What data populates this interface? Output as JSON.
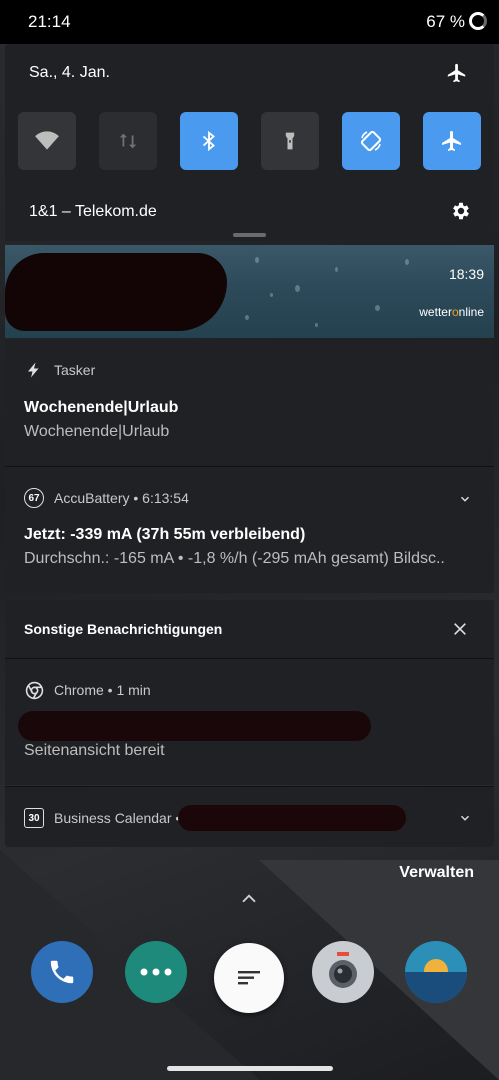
{
  "status_bar": {
    "time": "21:14",
    "battery": "67 %"
  },
  "quick_settings": {
    "date": "Sa., 4. Jan.",
    "operator": "1&1 – Telekom.de",
    "tiles": [
      {
        "icon": "wifi-icon",
        "state": "off"
      },
      {
        "icon": "mobile-data-icon",
        "state": "unavailable"
      },
      {
        "icon": "bluetooth-icon",
        "state": "on"
      },
      {
        "icon": "flashlight-icon",
        "state": "off"
      },
      {
        "icon": "auto-rotate-icon",
        "state": "on"
      },
      {
        "icon": "airplane-mode-icon",
        "state": "on"
      }
    ],
    "accent_color": "#4a9bef"
  },
  "weather": {
    "time": "18:39",
    "brand_left": "wetter",
    "brand_o": "o",
    "brand_right": "nline"
  },
  "notifications": {
    "tasker": {
      "app": "Tasker",
      "title": "Wochenende|Urlaub",
      "text": "Wochenende|Urlaub"
    },
    "accubattery": {
      "badge": "67",
      "app": "AccuBattery • 6:13:54",
      "title": "Jetzt: -339 mA (37h 55m verbleibend)",
      "text": "Durchschn.: -165 mA • -1,8 %/h (-295 mAh gesamt) Bildsc.."
    },
    "other_group": {
      "header": "Sonstige Benachrichtigungen",
      "chrome": {
        "app": "Chrome • 1 min",
        "text": "Seitenansicht bereit"
      },
      "calendar": {
        "badge": "30",
        "app": "Business Calendar •"
      }
    }
  },
  "manage_label": "Verwalten"
}
